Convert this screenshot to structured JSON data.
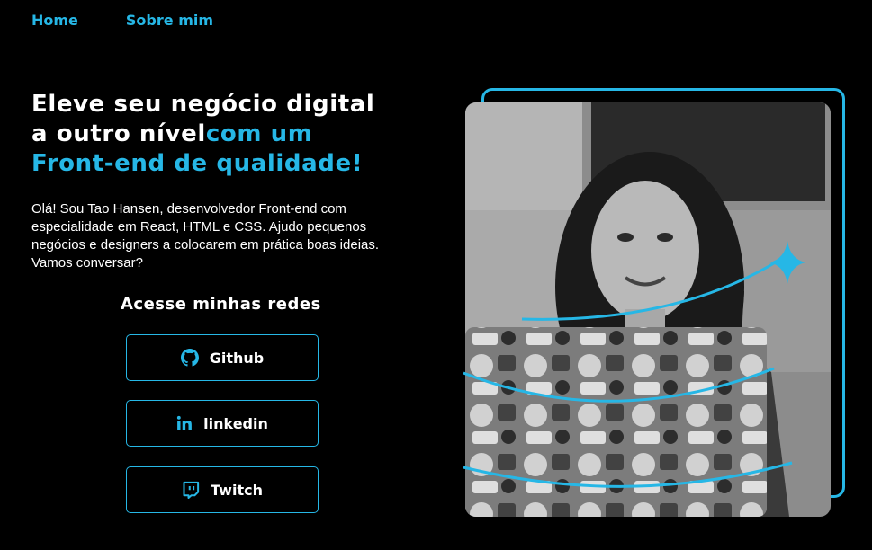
{
  "nav": {
    "home": "Home",
    "about": "Sobre mim"
  },
  "hero": {
    "title_line1": "Eleve seu negócio digital",
    "title_line2_white": "a outro nível",
    "title_line2_accent": "com um",
    "title_line3": "Front-end de qualidade!",
    "intro": "Olá! Sou Tao Hansen, desenvolvedor Front-end com especialidade em React, HTML e CSS. Ajudo pequenos negócios e designers a colocarem em prática boas ideias. Vamos conversar?"
  },
  "social": {
    "title": "Acesse minhas redes",
    "buttons": [
      {
        "label": "Github",
        "icon": "github-icon"
      },
      {
        "label": "linkedin",
        "icon": "linkedin-icon"
      },
      {
        "label": "Twitch",
        "icon": "twitch-icon"
      }
    ]
  },
  "colors": {
    "accent": "#26b7e6",
    "background": "#000000",
    "text": "#ffffff"
  },
  "image": {
    "subject": "woman-smiling-at-laptop-photo"
  }
}
